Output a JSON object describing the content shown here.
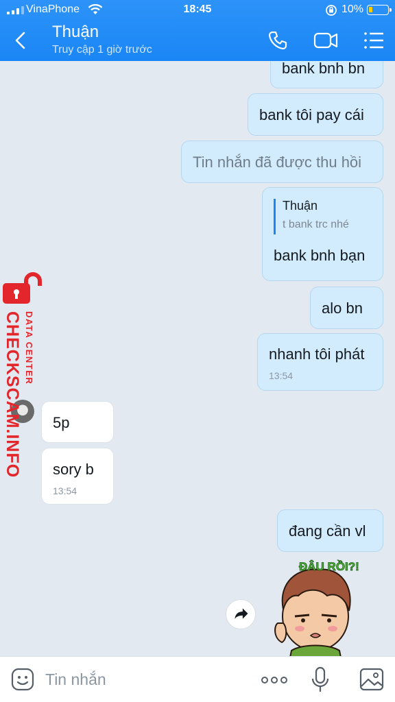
{
  "status_bar": {
    "carrier": "VinaPhone",
    "time": "18:45",
    "battery": "10%"
  },
  "header": {
    "title": "Thuận",
    "subtitle": "Truy cập 1 giờ trước"
  },
  "messages": [
    {
      "text": "bank bnh bn"
    },
    {
      "text": "bank tôi pay cái"
    },
    {
      "text": "Tin nhắn đã được thu hồi"
    },
    {
      "quote_name": "Thuận",
      "quote_text": "t bank trc nhé",
      "text": "bank bnh bạn"
    },
    {
      "text": "alo  bn"
    },
    {
      "text": "nhanh tôi phát",
      "time": "13:54"
    },
    {
      "text": "5p"
    },
    {
      "text": "sory b",
      "time": "13:54"
    },
    {
      "text": "đang cần vl"
    }
  ],
  "sticker": {
    "text": "ĐÂU RỒI?!"
  },
  "watermark": {
    "brand": "CHECKSCAM.INFO",
    "sub": "DATA CENTER"
  },
  "composer": {
    "placeholder": "Tin nhắn"
  },
  "colors": {
    "header": "#1a86f5",
    "my_bubble": "#d3ecfd",
    "their_bubble": "#ffffff",
    "background": "#e2e9f1",
    "watermark": "#e3262b"
  }
}
